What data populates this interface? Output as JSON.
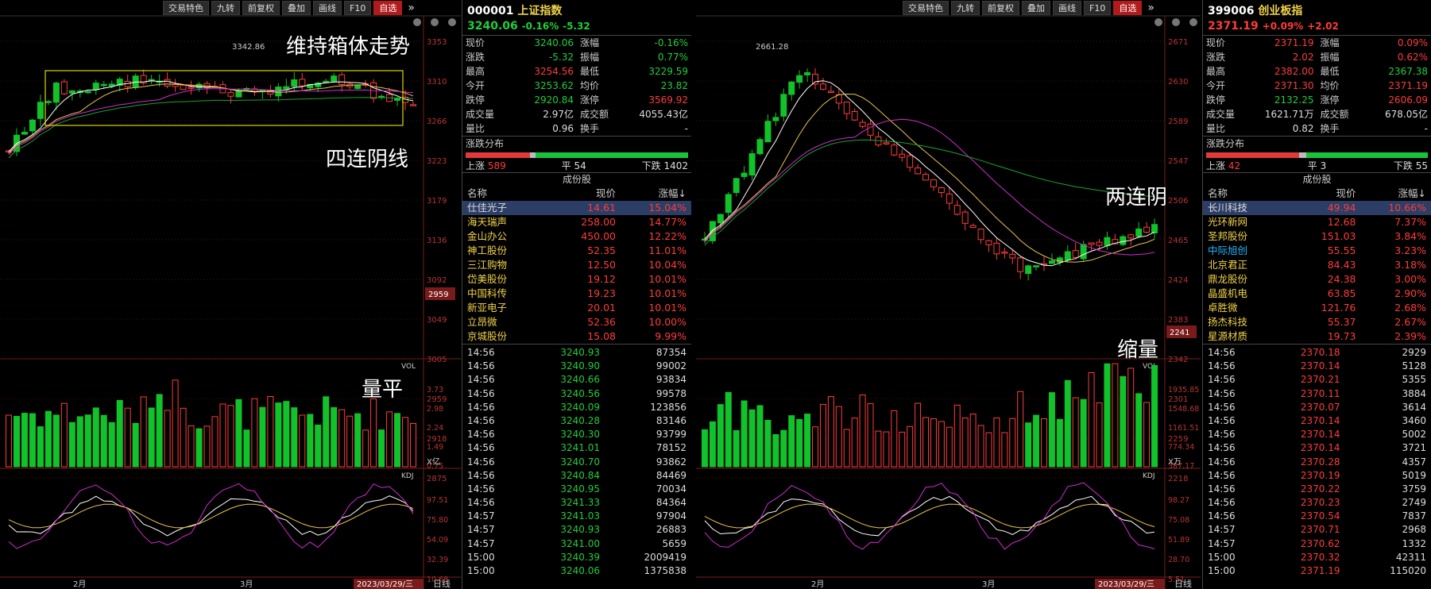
{
  "left_panel": {
    "toolbar": [
      "交易特色",
      "九转",
      "前复权",
      "叠加",
      "画线",
      "F10",
      "自选"
    ],
    "annotations": [
      "维持箱体走势",
      "四连阴线",
      "量平"
    ],
    "chart": {
      "price_axis": [
        "3353",
        "3310",
        "3266",
        "3223",
        "3179",
        "3136",
        "3092",
        "3049",
        "3005",
        "2959",
        "2918",
        "2875"
      ],
      "current_label": "2959",
      "high_label": "3342.86",
      "vol_label": "VOL",
      "vol_axis": [
        "3.73",
        "2.98",
        "2.24",
        "1.49",
        "0.75"
      ],
      "vol_unit": "X亿",
      "kdj_label": "KDJ",
      "kdj_axis": [
        "97.51",
        "75.80",
        "54.09",
        "32.39",
        "10.68"
      ],
      "x_labels": [
        "2月",
        "3月"
      ],
      "date_label": "2023/03/29/三",
      "period": "日线"
    },
    "info": {
      "code": "000001",
      "name": "上证指数",
      "price": "3240.06",
      "change_pct": "-0.16%",
      "change": "-5.32",
      "stats": [
        [
          "现价",
          "3240.06",
          "涨幅",
          "-0.16%"
        ],
        [
          "涨跌",
          "-5.32",
          "振幅",
          "0.77%"
        ],
        [
          "最高",
          "3254.56",
          "最低",
          "3229.59"
        ],
        [
          "今开",
          "3253.62",
          "均价",
          "23.82"
        ],
        [
          "跌停",
          "2920.84",
          "涨停",
          "3569.92"
        ],
        [
          "成交量",
          "2.97亿",
          "成交额",
          "4055.43亿"
        ],
        [
          "量比",
          "0.96",
          "换手",
          "-"
        ]
      ],
      "dist_title": "涨跌分布",
      "dist": {
        "up_label": "上涨",
        "up": "589",
        "flat_label": "平",
        "flat": "54",
        "down_label": "下跌",
        "down": "1402"
      },
      "table_title": "成份股",
      "table_headers": [
        "名称",
        "现价",
        "涨幅↓"
      ],
      "stocks": [
        [
          "仕佳光子",
          "14.61",
          "15.04%"
        ],
        [
          "海天瑞声",
          "258.00",
          "14.77%"
        ],
        [
          "金山办公",
          "450.00",
          "12.22%"
        ],
        [
          "神工股份",
          "52.35",
          "11.01%"
        ],
        [
          "三江购物",
          "12.50",
          "10.04%"
        ],
        [
          "岱美股份",
          "19.12",
          "10.01%"
        ],
        [
          "中国科传",
          "19.23",
          "10.01%"
        ],
        [
          "新亚电子",
          "20.01",
          "10.01%"
        ],
        [
          "立昂微",
          "52.36",
          "10.00%"
        ],
        [
          "京城股份",
          "15.08",
          "9.99%"
        ]
      ],
      "ticks": [
        [
          "14:56",
          "3240.93",
          "87354"
        ],
        [
          "14:56",
          "3240.90",
          "99002"
        ],
        [
          "14:56",
          "3240.66",
          "93834"
        ],
        [
          "14:56",
          "3240.56",
          "99578"
        ],
        [
          "14:56",
          "3240.09",
          "123856"
        ],
        [
          "14:56",
          "3240.28",
          "83146"
        ],
        [
          "14:56",
          "3240.30",
          "93799"
        ],
        [
          "14:56",
          "3241.01",
          "78152"
        ],
        [
          "14:56",
          "3240.70",
          "93862"
        ],
        [
          "14:56",
          "3240.84",
          "84469"
        ],
        [
          "14:56",
          "3240.95",
          "70034"
        ],
        [
          "14:56",
          "3241.33",
          "84364"
        ],
        [
          "14:57",
          "3241.03",
          "97904"
        ],
        [
          "14:57",
          "3240.93",
          "26883"
        ],
        [
          "14:57",
          "3241.00",
          "5659"
        ],
        [
          "15:00",
          "3240.39",
          "2009419"
        ],
        [
          "15:00",
          "3240.06",
          "1375838"
        ]
      ]
    }
  },
  "right_panel": {
    "toolbar": [
      "交易特色",
      "九转",
      "前复权",
      "叠加",
      "画线",
      "F10",
      "自选"
    ],
    "annotations": [
      "两连阴",
      "缩量"
    ],
    "chart": {
      "price_axis": [
        "2671",
        "2630",
        "2589",
        "2547",
        "2506",
        "2465",
        "2424",
        "2383",
        "2342",
        "2301",
        "2259",
        "2218"
      ],
      "current_label": "2241",
      "high_label": "2661.28",
      "vol_label": "VOL",
      "vol_axis": [
        "1935.85",
        "1548.68",
        "1161.51",
        "774.34",
        "387.17"
      ],
      "vol_unit": "X万",
      "kdj_label": "KDJ",
      "kdj_axis": [
        "98.27",
        "75.08",
        "51.89",
        "28.70",
        "5.51"
      ],
      "x_labels": [
        "2月",
        "3月"
      ],
      "date_label": "2023/03/29/三",
      "period": "日线"
    },
    "info": {
      "code": "399006",
      "name": "创业板指",
      "price": "2371.19",
      "change_pct": "+0.09%",
      "change": "+2.02",
      "stats": [
        [
          "现价",
          "2371.19",
          "涨幅",
          "0.09%"
        ],
        [
          "涨跌",
          "2.02",
          "振幅",
          "0.62%"
        ],
        [
          "最高",
          "2382.00",
          "最低",
          "2367.38"
        ],
        [
          "今开",
          "2371.30",
          "均价",
          "2371.19"
        ],
        [
          "跌停",
          "2132.25",
          "涨停",
          "2606.09"
        ],
        [
          "成交量",
          "1621.71万",
          "成交额",
          "678.05亿"
        ],
        [
          "量比",
          "0.82",
          "换手",
          "-"
        ]
      ],
      "dist_title": "涨跌分布",
      "dist": {
        "up_label": "上涨",
        "up": "42",
        "flat_label": "平",
        "flat": "3",
        "down_label": "下跌",
        "down": "55"
      },
      "table_title": "成份股",
      "table_headers": [
        "名称",
        "现价",
        "涨幅↓"
      ],
      "stocks": [
        [
          "长川科技",
          "49.94",
          "10.66%"
        ],
        [
          "光环新网",
          "12.68",
          "7.37%"
        ],
        [
          "圣邦股份",
          "151.03",
          "3.84%"
        ],
        [
          "中际旭创",
          "55.55",
          "3.23%"
        ],
        [
          "北京君正",
          "84.43",
          "3.18%"
        ],
        [
          "鼎龙股份",
          "24.38",
          "3.00%"
        ],
        [
          "晶盛机电",
          "63.85",
          "2.90%"
        ],
        [
          "卓胜微",
          "121.76",
          "2.68%"
        ],
        [
          "扬杰科技",
          "55.37",
          "2.67%"
        ],
        [
          "星源材质",
          "19.73",
          "2.39%"
        ]
      ],
      "ticks": [
        [
          "14:56",
          "2370.18",
          "2929"
        ],
        [
          "14:56",
          "2370.14",
          "5128"
        ],
        [
          "14:56",
          "2370.21",
          "5355"
        ],
        [
          "14:56",
          "2370.11",
          "3884"
        ],
        [
          "14:56",
          "2370.07",
          "3614"
        ],
        [
          "14:56",
          "2370.14",
          "3460"
        ],
        [
          "14:56",
          "2370.14",
          "5002"
        ],
        [
          "14:56",
          "2370.14",
          "3721"
        ],
        [
          "14:56",
          "2370.28",
          "4357"
        ],
        [
          "14:56",
          "2370.19",
          "5019"
        ],
        [
          "14:56",
          "2370.22",
          "3759"
        ],
        [
          "14:56",
          "2370.23",
          "2749"
        ],
        [
          "14:56",
          "2370.54",
          "7837"
        ],
        [
          "14:57",
          "2370.71",
          "2968"
        ],
        [
          "14:57",
          "2370.62",
          "1332"
        ],
        [
          "15:00",
          "2370.32",
          "42311"
        ],
        [
          "15:00",
          "2371.19",
          "115020"
        ]
      ]
    }
  }
}
